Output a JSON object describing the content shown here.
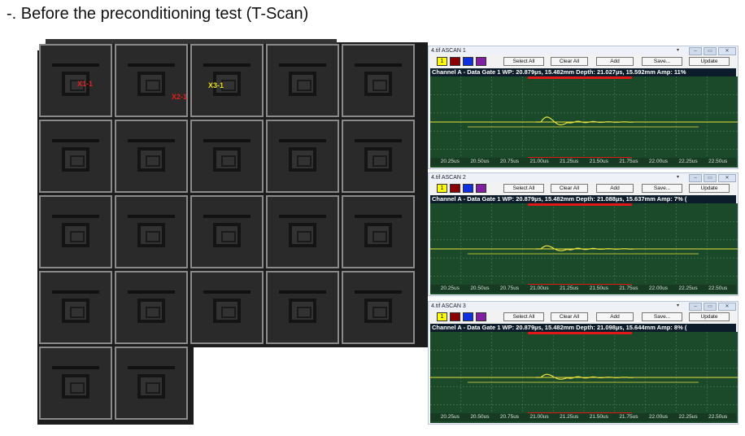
{
  "heading": "-. Before the preconditioning test (T-Scan)",
  "tscan": {
    "markers": [
      {
        "label": "X1-1",
        "color": "red"
      },
      {
        "label": "X2-1",
        "color": "red"
      },
      {
        "label": "X3-1",
        "color": "yellow"
      }
    ]
  },
  "ascan_toolbar": {
    "swatch1": "1",
    "select_all": "Select All",
    "clear_all": "Clear All",
    "add": "Add",
    "save": "Save...",
    "update": "Update"
  },
  "panels": [
    {
      "title": "4.tif ASCAN 1",
      "channel": "Channel A - Data Gate 1 WP: 20.879µs, 15.482mm  Depth: 21.027µs, 15.592mm  Amp: 11%"
    },
    {
      "title": "4.tif ASCAN 2",
      "channel": "Channel A - Data Gate 1 WP: 20.879µs, 15.482mm  Depth: 21.088µs, 15.637mm  Amp: 7% ("
    },
    {
      "title": "4.tif ASCAN 3",
      "channel": "Channel A - Data Gate 1 WP: 20.879µs, 15.482mm  Depth: 21.098µs, 15.644mm  Amp: 8% ("
    }
  ],
  "time_axis": [
    "20.25us",
    "20.50us",
    "20.75us",
    "21.00us",
    "21.25us",
    "21.50us",
    "21.75us",
    "22.00us",
    "22.25us",
    "22.50us"
  ],
  "colors": {
    "plot_bg": "#1a4a2a",
    "trace": "#e8e040",
    "gate": "#e01818",
    "swatches": [
      "#ffff00",
      "#8b0000",
      "#1030e0",
      "#8020a0"
    ]
  },
  "icons": [
    "dropdown-arrow-icon",
    "minimize-icon",
    "maximize-icon",
    "close-icon"
  ]
}
